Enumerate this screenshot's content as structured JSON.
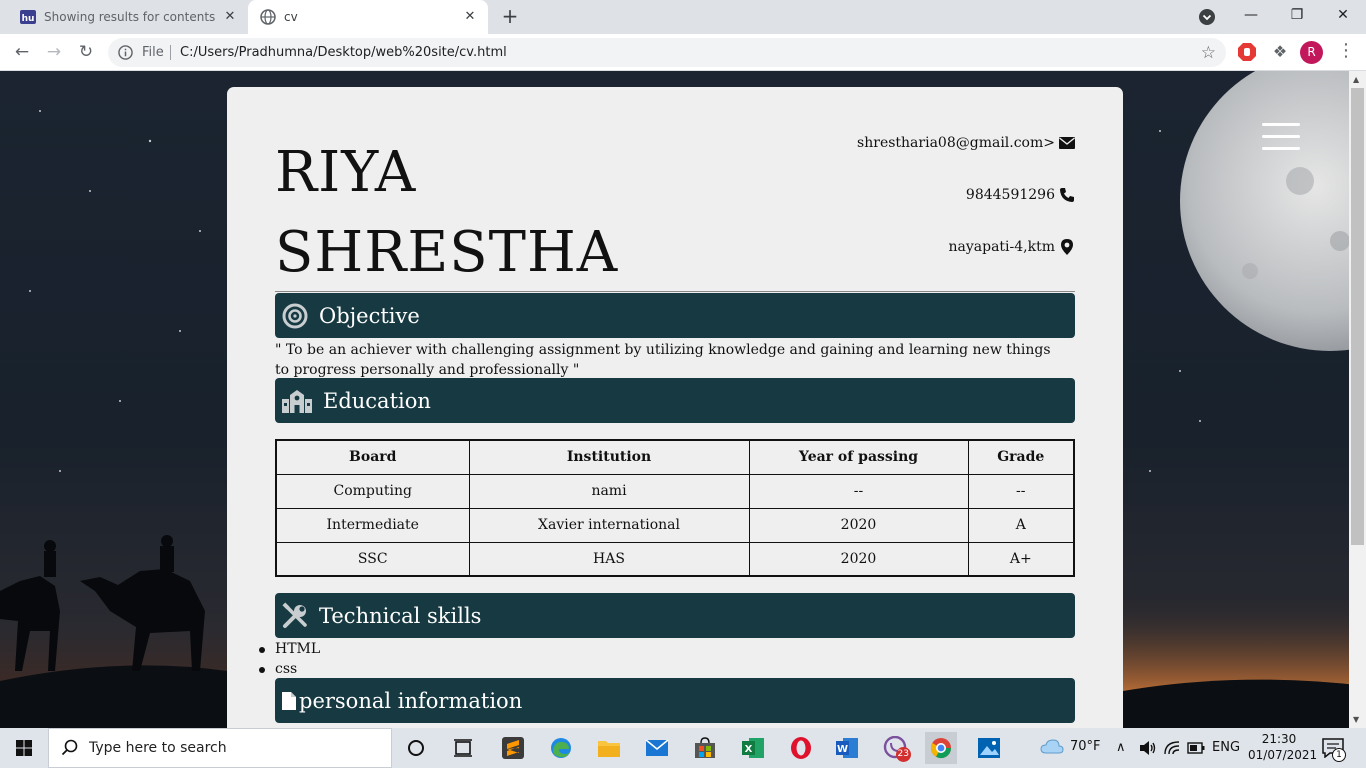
{
  "browser": {
    "tabs": [
      {
        "title": "Showing results for contents of t",
        "favicon": "hu-logo-icon"
      },
      {
        "title": "cv",
        "favicon": "globe-icon"
      }
    ],
    "new_tab_label": "+",
    "close_glyph": "✕",
    "omnibox": {
      "site_info_label": "File",
      "url": "C:/Users/Pradhumna/Desktop/web%20site/cv.html"
    },
    "profile_initial": "R"
  },
  "cv": {
    "first_name": "RIYA",
    "last_name": "SHRESTHA",
    "email": "shrestharia08@gmail.com>",
    "phone": "9844591296",
    "address": "nayapati-4,ktm",
    "sections": {
      "objective": "Objective",
      "education": "Education",
      "skills": "Technical skills",
      "personal": "personal information"
    },
    "objective_text": "\" To be an achiever with challenging assignment by utilizing knowledge and gaining and learning new things to progress personally and professionally \"",
    "education_table": {
      "headers": [
        "Board",
        "Institution",
        "Year of passing",
        "Grade"
      ],
      "rows": [
        [
          "Computing",
          "nami",
          "--",
          "--"
        ],
        [
          "Intermediate",
          "Xavier international",
          "2020",
          "A"
        ],
        [
          "SSC",
          "HAS",
          "2020",
          "A+"
        ]
      ]
    },
    "skills": [
      "HTML",
      "css"
    ]
  },
  "taskbar": {
    "search_placeholder": "Type here to search",
    "viber_badge": "23",
    "weather_temp": "70°F",
    "language": "ENG",
    "time": "21:30",
    "date": "01/07/2021",
    "notification_count": "1"
  },
  "colors": {
    "section_bar": "#173a42",
    "card_bg": "#efefef",
    "profile_avatar": "#c2185b"
  }
}
